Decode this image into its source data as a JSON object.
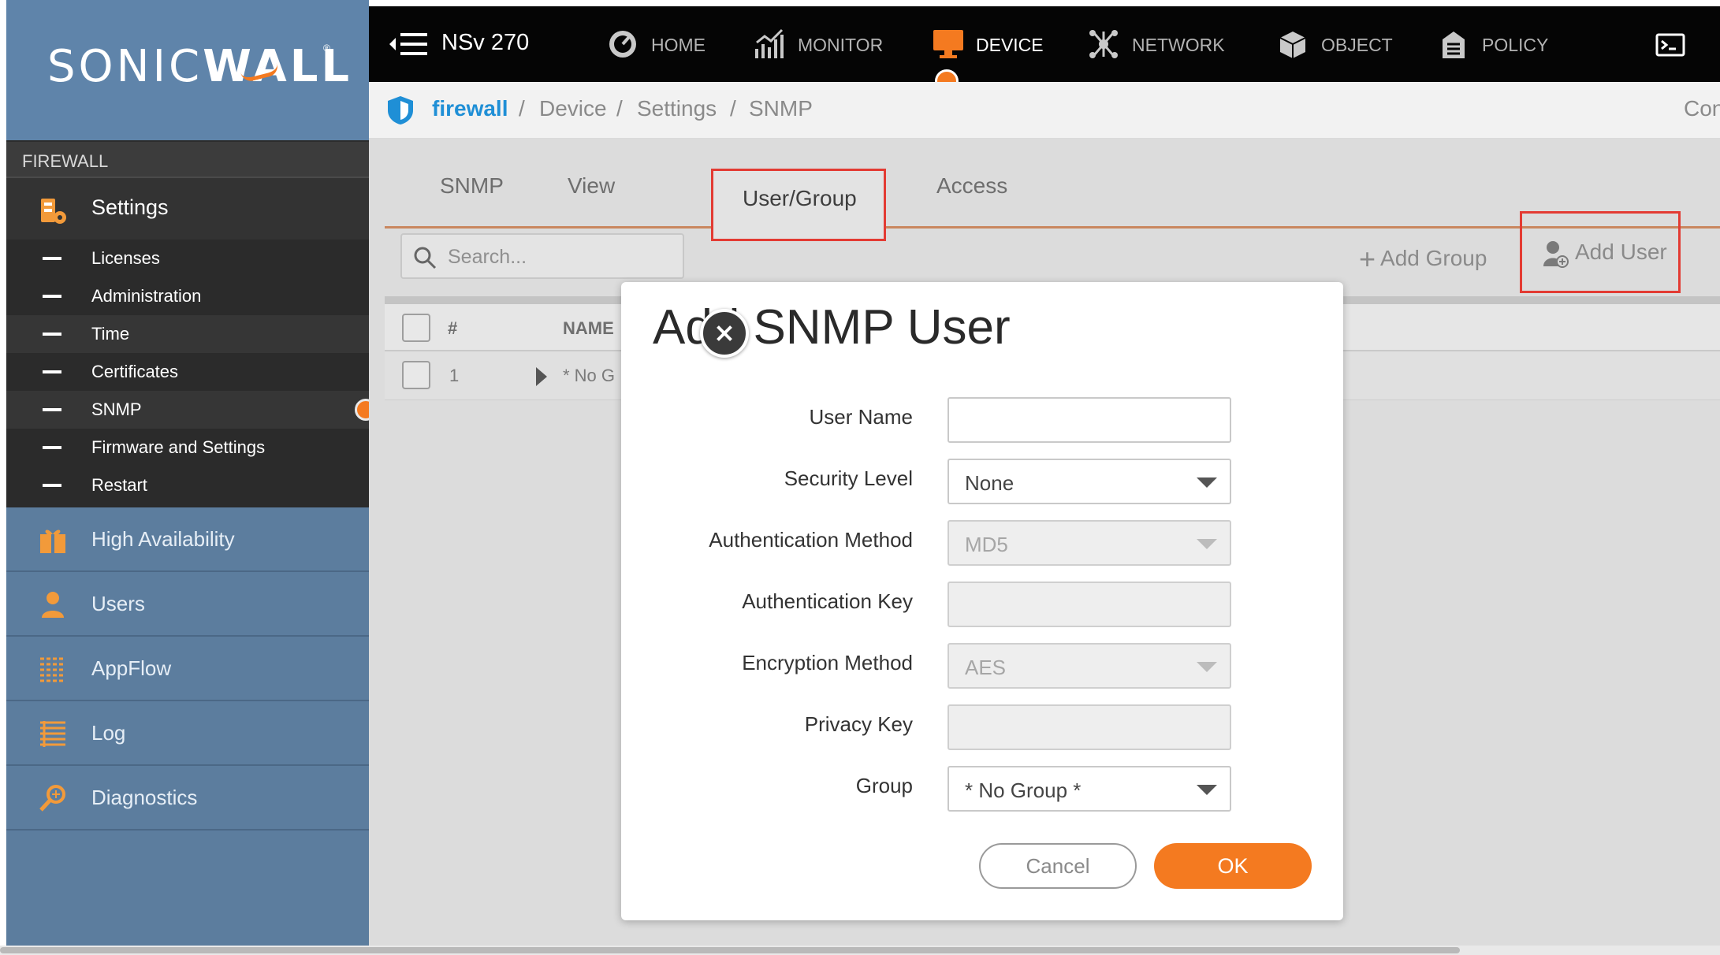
{
  "brand": {
    "logo_text_light": "SONIC",
    "logo_text_bold": "WALL"
  },
  "sidebar": {
    "section": "FIREWALL",
    "settings_label": "Settings",
    "sub_items": [
      "Licenses",
      "Administration",
      "Time",
      "Certificates",
      "SNMP",
      "Firmware and Settings",
      "Restart"
    ],
    "active_sub_item": "SNMP",
    "nav_items": [
      {
        "label": "High Availability",
        "icon": "gift-icon"
      },
      {
        "label": "Users",
        "icon": "user-icon"
      },
      {
        "label": "AppFlow",
        "icon": "appflow-icon"
      },
      {
        "label": "Log",
        "icon": "log-icon"
      },
      {
        "label": "Diagnostics",
        "icon": "diagnostics-icon"
      }
    ]
  },
  "topbar": {
    "device_name": "NSv 270",
    "nav": [
      {
        "label": "HOME",
        "icon": "gauge-icon"
      },
      {
        "label": "MONITOR",
        "icon": "chart-icon"
      },
      {
        "label": "DEVICE",
        "icon": "monitor-icon",
        "active": true
      },
      {
        "label": "NETWORK",
        "icon": "network-icon"
      },
      {
        "label": "OBJECT",
        "icon": "cube-icon"
      },
      {
        "label": "POLICY",
        "icon": "policy-icon"
      }
    ]
  },
  "breadcrumb": {
    "root": "firewall",
    "items": [
      "Device",
      "Settings",
      "SNMP"
    ],
    "separator": "/",
    "right_truncated": "Con"
  },
  "tabs": [
    "SNMP",
    "View",
    "User/Group",
    "Access"
  ],
  "active_tab": "User/Group",
  "toolbar": {
    "search_placeholder": "Search...",
    "add_group": "Add Group",
    "add_user": "Add User"
  },
  "table": {
    "headers": [
      "#",
      "NAME"
    ],
    "rows": [
      {
        "index": "1",
        "name": "* No G"
      }
    ]
  },
  "modal": {
    "title": "Add SNMP User",
    "fields": {
      "user_name": {
        "label": "User Name",
        "value": ""
      },
      "security_level": {
        "label": "Security Level",
        "value": "None"
      },
      "auth_method": {
        "label": "Authentication Method",
        "value": "MD5"
      },
      "auth_key": {
        "label": "Authentication Key",
        "value": ""
      },
      "enc_method": {
        "label": "Encryption Method",
        "value": "AES"
      },
      "privacy_key": {
        "label": "Privacy Key",
        "value": ""
      },
      "group": {
        "label": "Group",
        "value": "* No Group *"
      }
    },
    "cancel": "Cancel",
    "ok": "OK"
  },
  "colors": {
    "accent": "#f47a20",
    "link": "#1f8fd6",
    "highlight_box": "#e33b33",
    "sidebar": "#5c7d9e"
  }
}
